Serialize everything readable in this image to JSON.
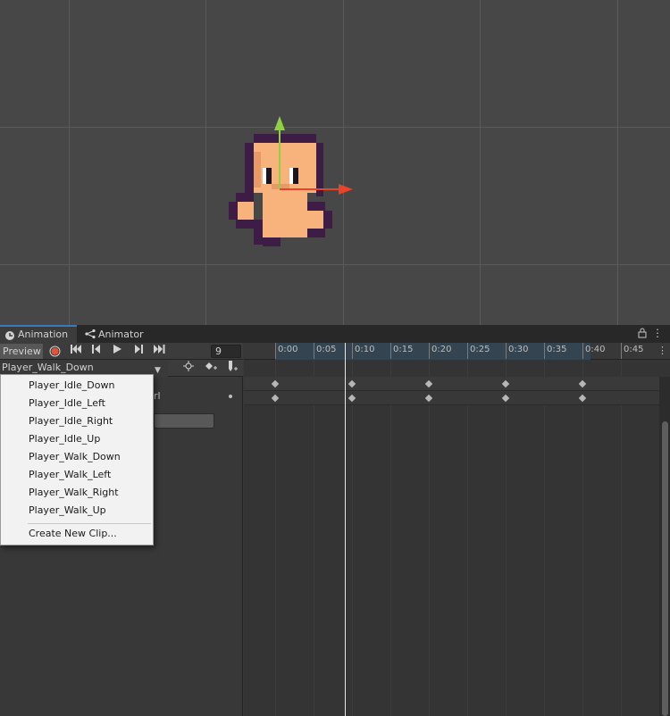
{
  "tabs": [
    {
      "label": "Animation",
      "active": true
    },
    {
      "label": "Animator",
      "active": false
    }
  ],
  "toolbar": {
    "preview_label": "Preview",
    "frame_value": "9"
  },
  "clip": {
    "selected": "Player_Walk_Down"
  },
  "property_panel": {
    "label_tail": "rl"
  },
  "ruler": {
    "labels": [
      "0:00",
      "0:05",
      "0:10",
      "0:15",
      "0:20",
      "0:25",
      "0:30",
      "0:35",
      "0:40",
      "0:45"
    ]
  },
  "dropdown": {
    "items": [
      "Player_Idle_Down",
      "Player_Idle_Left",
      "Player_Idle_Right",
      "Player_Idle_Up",
      "Player_Walk_Down",
      "Player_Walk_Left",
      "Player_Walk_Right",
      "Player_Walk_Up"
    ],
    "selected_index": 4,
    "create_label": "Create New Clip..."
  },
  "colors": {
    "accent": "#3a79bb",
    "record": "#e0553a",
    "gizmo_y": "#8fd13f",
    "gizmo_x": "#e8442a",
    "check": "#2f7fd0"
  }
}
